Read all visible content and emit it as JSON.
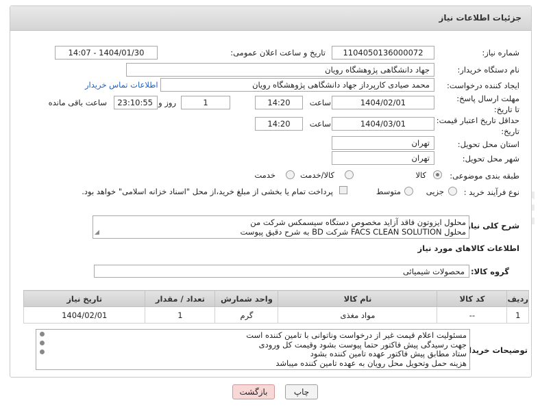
{
  "header": {
    "title": "جزئیات اطلاعات نیاز"
  },
  "form": {
    "need_number_label": "شماره نیاز:",
    "need_number": "1104050136000072",
    "announce_label": "تاریخ و ساعت اعلان عمومی:",
    "announce_value": "1404/01/30 - 14:07",
    "buyer_org_label": "نام دستگاه خریدار:",
    "buyer_org": "جهاد دانشگاهی پژوهشگاه رویان",
    "creator_label": "ایجاد کننده درخواست:",
    "creator": "محمد صیادی کارپرداز جهاد دانشگاهی پژوهشگاه رویان",
    "contact_link": "اطلاعات تماس خریدار",
    "reply_deadline_label": "مهلت ارسال پاسخ: تا تاریخ:",
    "reply_date": "1404/02/01",
    "time_label": "ساعت",
    "reply_time": "14:20",
    "day_value": "1",
    "day_and_label": "روز و",
    "remaining_time": "23:10:55",
    "remaining_label": "ساعت باقی مانده",
    "price_validity_label": "حداقل تاریخ اعتبار قیمت: تا تاریخ:",
    "price_date": "1404/03/01",
    "price_time": "14:20",
    "province_label": "استان محل تحویل:",
    "province": "تهران",
    "city_label": "شهر محل تحویل:",
    "city": "تهران",
    "category_label": "طبقه بندی موضوعی:",
    "category_options": [
      "کالا",
      "کالا/خدمت",
      "خدمت"
    ],
    "process_label": "نوع فرآیند خرید :",
    "process_options": [
      "جزیی",
      "متوسط"
    ],
    "payment_note": "پرداخت تمام یا بخشی از مبلغ خرید،از محل \"اسناد خزانه اسلامی\" خواهد بود."
  },
  "description": {
    "label": "شرح کلی نیاز:",
    "line1": "محلول ایزوتون فاقد آزاید مخصوص دستگاه سیسمکس شرکت من",
    "line2": "محلول FACS CLEAN SOLUTION     شرکت    BD به شرح دقیق پیوست"
  },
  "goods_info_title": "اطلاعات کالاهای مورد نیاز",
  "goods_group": {
    "label": "گروه کالا:",
    "value": "محصولات شیمیائی"
  },
  "table": {
    "headers": [
      "ردیف",
      "کد کالا",
      "نام کالا",
      "واحد شمارش",
      "تعداد / مقدار",
      "تاریخ نیاز"
    ],
    "rows": [
      [
        "1",
        "--",
        "مواد مغذی",
        "گرم",
        "1",
        "1404/02/01"
      ]
    ]
  },
  "buyer_notes": {
    "label": "توضیحات خریدار:",
    "lines": [
      "مسئولیت اعلام قیمت  غیر از درخواست وناتوانی با تامین کننده است",
      "جهت رسیدگی پیش فاکتور حتما پیوست بشود وقیمت کل ورودی",
      "ستاد مطابق پیش فاکتور عهده تامین کننده بشود",
      "هزینه حمل وتحویل محل رویان به عهده تامین کننده میباشد"
    ]
  },
  "buttons": {
    "print": "چاپ",
    "back": "بازگشت"
  },
  "colors": {
    "header_bg": "#dcdcdc",
    "link": "#1f5fbf",
    "back_btn": "#f8d7d7"
  }
}
